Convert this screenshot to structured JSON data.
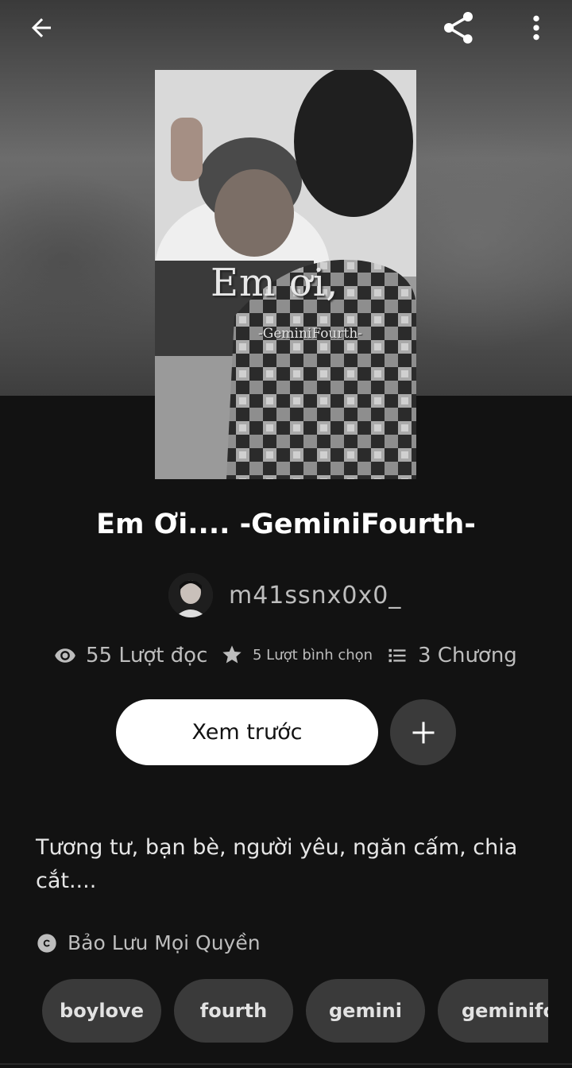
{
  "story": {
    "title": "Em Ơi.... -GeminiFourth-",
    "cover_title": "Em ơi,",
    "cover_subtitle": "-GeminiFourth-",
    "author": "m41ssnx0x0_",
    "description": "Tương tư, bạn bè, người yêu, ngăn cấm, chia cắt....",
    "copyright": "Bảo Lưu Mọi Quyền"
  },
  "stats": {
    "reads": "55 Lượt đọc",
    "votes": "5 Lượt bình chọn",
    "chapters": "3 Chương"
  },
  "actions": {
    "preview_label": "Xem trước"
  },
  "tags": [
    "boylove",
    "fourth",
    "gemini",
    "geminifourth"
  ],
  "icons": {
    "back": "arrow-left-icon",
    "share": "share-icon",
    "more": "more-vertical-icon",
    "eye": "eye-icon",
    "star": "star-icon",
    "list": "list-icon",
    "plus": "plus-icon",
    "copyright": "copyright-icon"
  }
}
